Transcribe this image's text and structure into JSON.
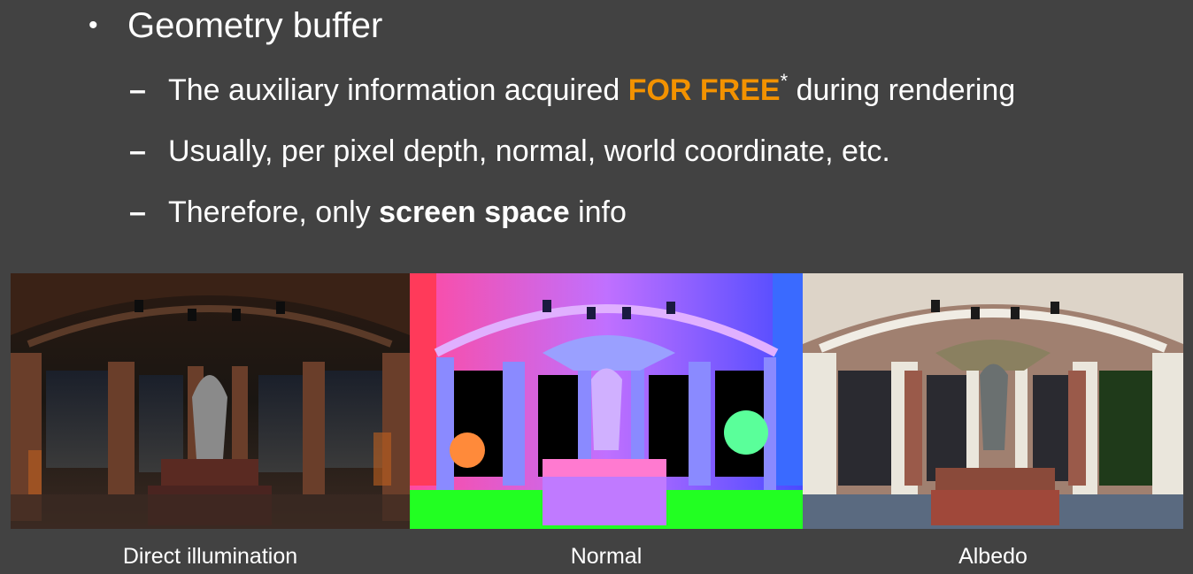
{
  "heading": "Geometry buffer",
  "bullets": [
    {
      "before": "The auxiliary information acquired ",
      "highlight": "FOR FREE",
      "sup": "*",
      "after": " during rendering"
    },
    {
      "text": "Usually, per pixel depth, normal, world coordinate, etc."
    },
    {
      "before": "Therefore, only ",
      "bold": "screen space",
      "after": " info"
    }
  ],
  "dash": "–",
  "bullet_symbol": "•",
  "images": [
    {
      "caption": "Direct illumination",
      "icon": "render-direct-illumination"
    },
    {
      "caption": "Normal",
      "icon": "render-normal-buffer"
    },
    {
      "caption": "Albedo",
      "icon": "render-albedo-buffer"
    }
  ],
  "colors": {
    "background": "#424242",
    "text": "#ffffff",
    "accent": "#f39200"
  }
}
